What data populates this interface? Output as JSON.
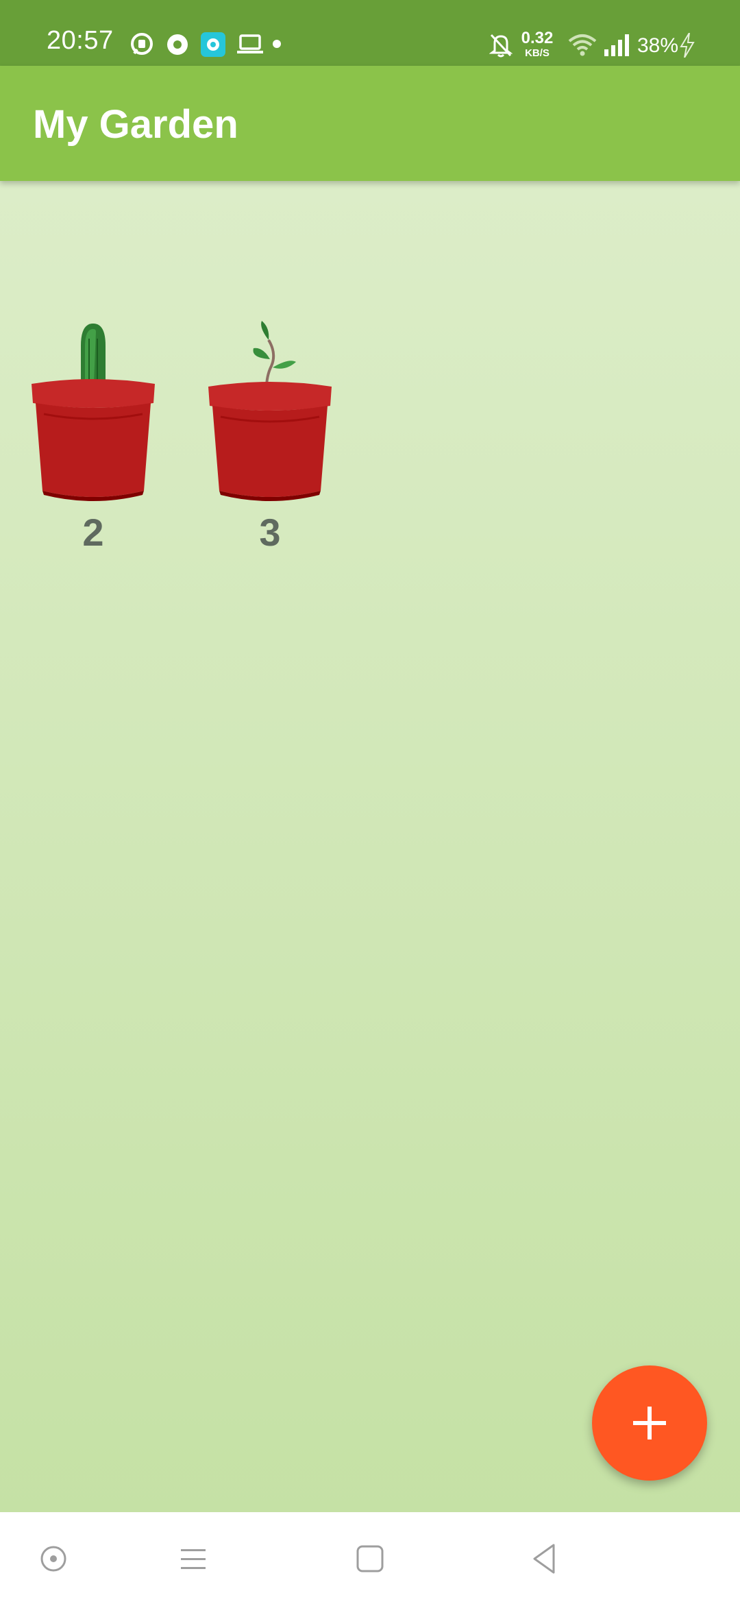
{
  "status_bar": {
    "time": "20:57",
    "net_speed_value": "0.32",
    "net_speed_unit": "KB/S",
    "battery": "38%",
    "icons": [
      "message-icon",
      "location-icon",
      "app-icon",
      "laptop-icon",
      "dot-icon",
      "bell-off-icon",
      "wifi-icon",
      "signal-icon",
      "charging-icon"
    ]
  },
  "app_bar": {
    "title": "My Garden"
  },
  "garden": {
    "plants": [
      {
        "label": "2",
        "type": "cactus"
      },
      {
        "label": "3",
        "type": "sprout"
      }
    ]
  },
  "fab": {
    "icon": "plus-icon",
    "color": "#ff5722"
  },
  "nav_bar": {
    "buttons": [
      "assistant-icon",
      "menu-icon",
      "home-icon",
      "back-icon"
    ]
  },
  "colors": {
    "status_bar": "#689f38",
    "app_bar": "#8bc34a",
    "pot": "#c62828"
  }
}
